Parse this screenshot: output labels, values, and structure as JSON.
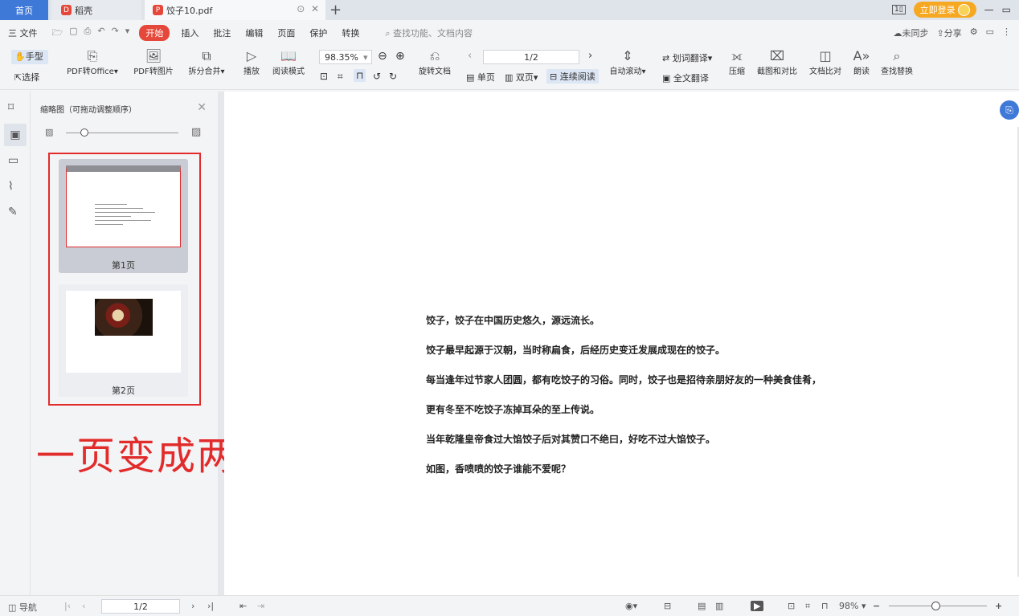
{
  "tabs": {
    "home": "首页",
    "daoke": "稻壳",
    "file": "饺子10.pdf",
    "new_tab_icon": "+"
  },
  "window": {
    "login": "立即登录"
  },
  "menu": {
    "file": "三 文件",
    "start": "开始",
    "items": [
      "插入",
      "批注",
      "编辑",
      "页面",
      "保护",
      "转换"
    ],
    "search_placeholder": "查找功能、文档内容",
    "sync": "未同步",
    "share": "分享"
  },
  "ribbon": {
    "hand": "手型",
    "select": "选择",
    "pdf_to_office": "PDF转Office",
    "pdf_to_image": "PDF转图片",
    "split_merge": "拆分合并",
    "play": "播放",
    "read_mode": "阅读模式",
    "zoom": "98.35%",
    "rotate": "旋转文档",
    "page_indicator": "1/2",
    "single": "单页",
    "double": "双页",
    "continuous": "连续阅读",
    "auto_scroll": "自动滚动",
    "word_translate": "划词翻译",
    "full_translate": "全文翻译",
    "compress": "压缩",
    "screenshot": "截图和对比",
    "compare": "文档比对",
    "read_aloud": "朗读",
    "find_replace": "查找替换"
  },
  "panel": {
    "title": "缩略图（可拖动调整顺序）",
    "page1_label": "第1页",
    "page2_label": "第2页"
  },
  "overlay": {
    "annotation": "一页变成两页"
  },
  "document": {
    "lines": [
      "饺子，饺子在中国历史悠久，源远流长。",
      "饺子最早起源于汉朝，当时称扁食，后经历史变迁发展成现在的饺子。",
      "每当逢年过节家人团圆，都有吃饺子的习俗。同时，饺子也是招待亲朋好友的一种美食佳肴，",
      "更有冬至不吃饺子冻掉耳朵的至上传说。",
      "当年乾隆皇帝食过大馅饺子后对其赞口不绝曰，好吃不过大馅饺子。",
      "如图，香喷喷的饺子谁能不爱呢？"
    ]
  },
  "status": {
    "nav": "导航",
    "page": "1/2",
    "zoom": "98%"
  },
  "colors": {
    "accent": "#3f79d8",
    "annotation_red": "#e22b2b",
    "start_red": "#e5483b",
    "login_orange": "#f6a823"
  }
}
